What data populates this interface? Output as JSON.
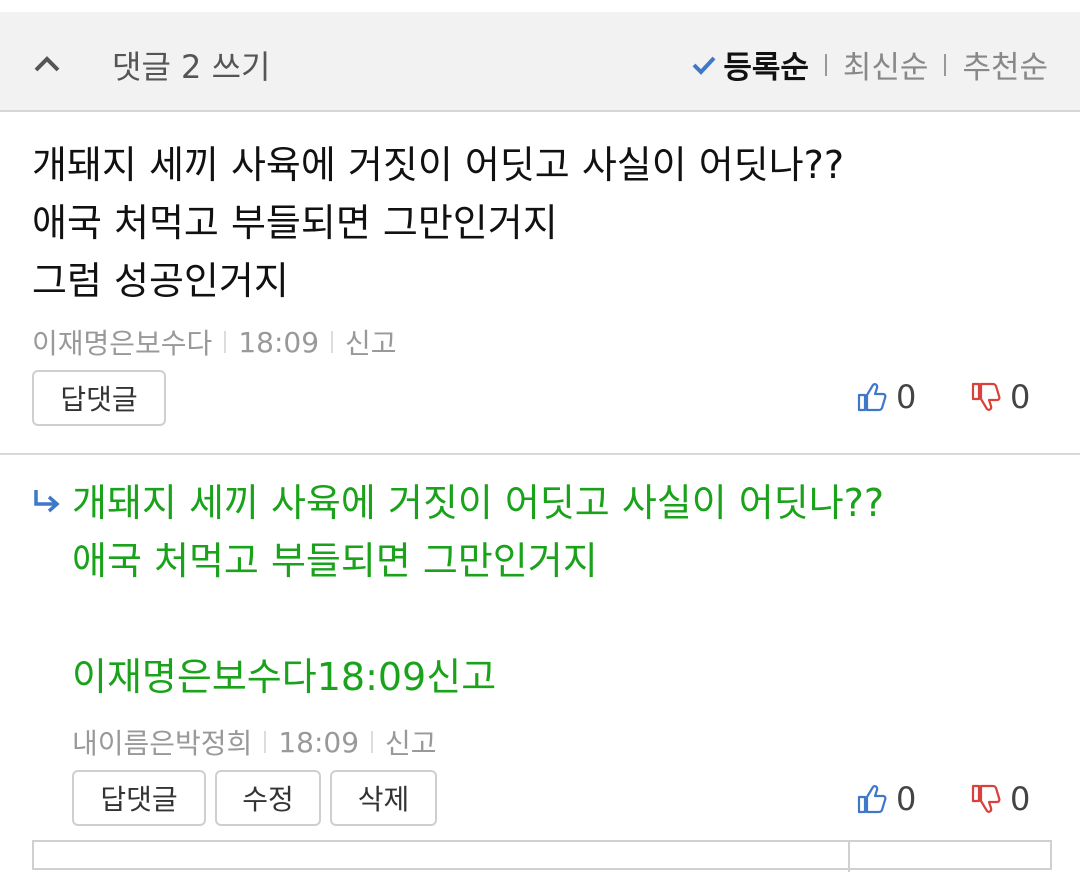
{
  "header": {
    "title": "댓글 2 쓰기",
    "sort": {
      "active": "등록순",
      "recent": "최신순",
      "recommended": "추천순"
    }
  },
  "comments": [
    {
      "lines": [
        "개돼지 세끼 사육에 거짓이 어딧고 사실이 어딧나??",
        "애국 처먹고 부들되면 그만인거지",
        "그럼 성공인거지"
      ],
      "author": "이재명은보수다",
      "time": "18:09",
      "report": "신고",
      "reply_button": "답댓글",
      "likes": "0",
      "dislikes": "0"
    }
  ],
  "reply": {
    "lines": [
      "개돼지 세끼 사육에 거짓이 어딧고 사실이 어딧나??",
      "애국 처먹고 부들되면 그만인거지",
      "",
      "이재명은보수다18:09신고"
    ],
    "author": "내이름은박정희",
    "time": "18:09",
    "report": "신고",
    "reply_button": "답댓글",
    "edit_button": "수정",
    "delete_button": "삭제",
    "likes": "0",
    "dislikes": "0"
  },
  "colors": {
    "reply_text": "#1aa31a",
    "like_icon": "#3f78c9",
    "dislike_icon": "#d9413b",
    "check": "#3f78c9"
  },
  "icons": [
    "chevron-up-icon",
    "check-icon",
    "thumbs-up-icon",
    "thumbs-down-icon",
    "reply-arrow-icon"
  ]
}
